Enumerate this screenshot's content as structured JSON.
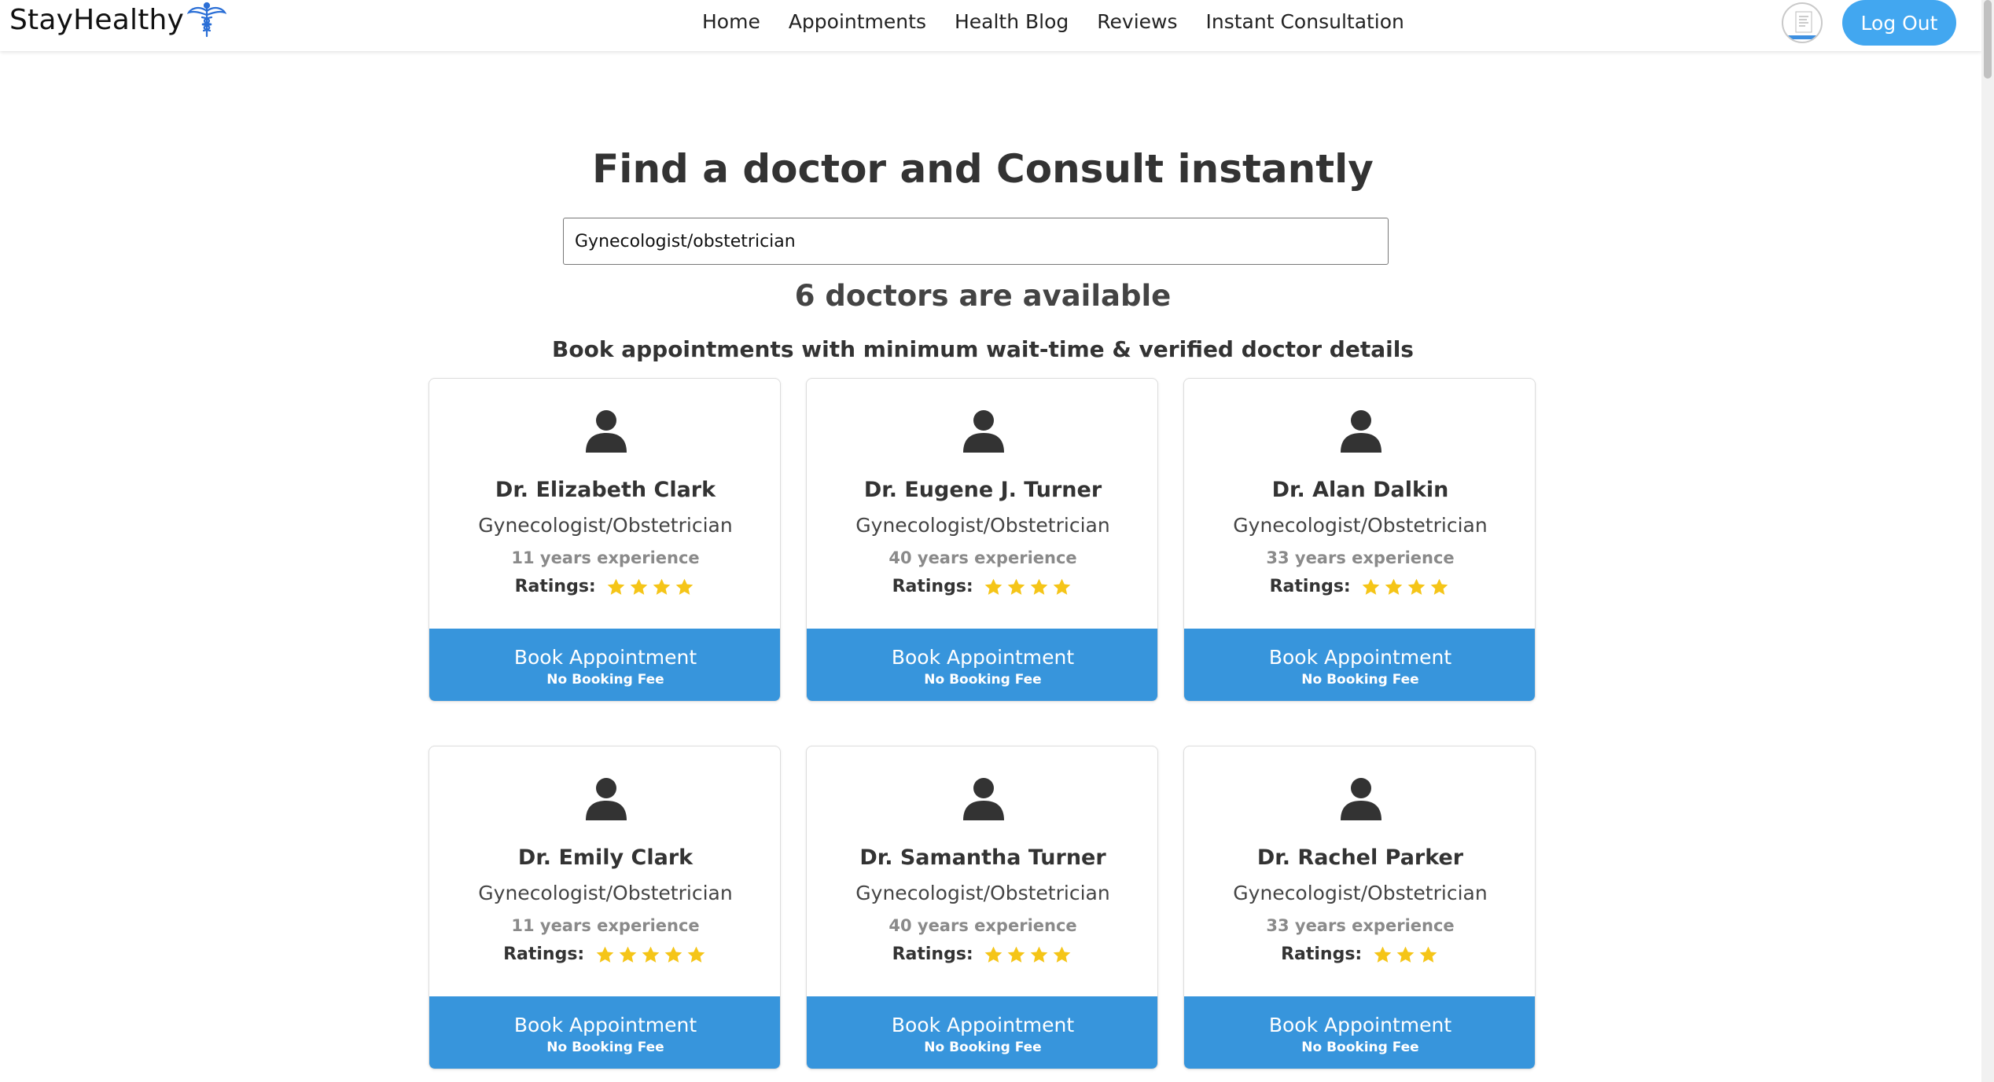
{
  "brand": {
    "name": "StayHealthy",
    "icon": "caduceus-icon",
    "icon_color": "#2b6fd6"
  },
  "nav": {
    "links": [
      "Home",
      "Appointments",
      "Health Blog",
      "Reviews",
      "Instant Consultation"
    ],
    "logout_label": "Log Out",
    "avatar": "user-avatar-icon",
    "accent": "#42a7f0"
  },
  "main": {
    "title": "Find a doctor and Consult instantly",
    "search_value": "Gynecologist/obstetrician",
    "count_text": "6 doctors are available",
    "subtitle": "Book appointments with minimum wait-time & verified doctor details"
  },
  "card_labels": {
    "ratings": "Ratings:",
    "book": "Book Appointment",
    "fee": "No Booking Fee",
    "button_color": "#3795dc",
    "star_color": "#f5c518",
    "icon": "person-icon"
  },
  "doctors": [
    {
      "name": "Dr. Elizabeth Clark",
      "speciality": "Gynecologist/Obstetrician",
      "experience": "11 years experience",
      "rating": 4
    },
    {
      "name": "Dr. Eugene J. Turner",
      "speciality": "Gynecologist/Obstetrician",
      "experience": "40 years experience",
      "rating": 4
    },
    {
      "name": "Dr. Alan Dalkin",
      "speciality": "Gynecologist/Obstetrician",
      "experience": "33 years experience",
      "rating": 4
    },
    {
      "name": "Dr. Emily Clark",
      "speciality": "Gynecologist/Obstetrician",
      "experience": "11 years experience",
      "rating": 5
    },
    {
      "name": "Dr. Samantha Turner",
      "speciality": "Gynecologist/Obstetrician",
      "experience": "40 years experience",
      "rating": 4
    },
    {
      "name": "Dr. Rachel Parker",
      "speciality": "Gynecologist/Obstetrician",
      "experience": "33 years experience",
      "rating": 3
    }
  ]
}
